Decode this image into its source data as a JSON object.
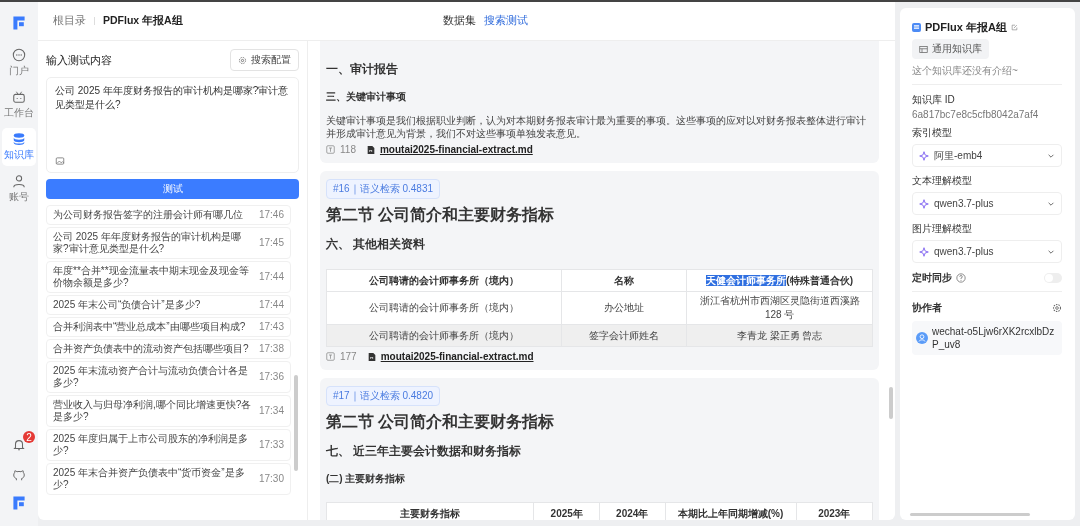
{
  "rail": {
    "items": [
      {
        "label": "门户",
        "kind": "chat",
        "selected": false
      },
      {
        "label": "工作台",
        "kind": "robot",
        "selected": false
      },
      {
        "label": "知识库",
        "kind": "database",
        "selected": true
      },
      {
        "label": "账号",
        "kind": "person",
        "selected": false
      }
    ],
    "notification_count": "2"
  },
  "breadcrumb": [
    "根目录",
    "PDFlux 年报A组"
  ],
  "nav_tabs": [
    {
      "label": "数据集",
      "selected": false
    },
    {
      "label": "搜索测试",
      "selected": true
    }
  ],
  "test_panel": {
    "title": "输入测试内容",
    "config_button": "搜索配置",
    "query": "公司 2025 年年度财务报告的审计机构是哪家?审计意见类型是什么?",
    "submit_button": "测试",
    "history": [
      {
        "question": "为公司财务报告签字的注册会计师有哪几位",
        "time": "17:46"
      },
      {
        "question": "公司 2025 年年度财务报告的审计机构是哪家?审计意见类型是什么?",
        "time": "17:45"
      },
      {
        "question": "年度**合并**现金流量表中期末现金及现金等价物余额是多少?",
        "time": "17:44"
      },
      {
        "question": "2025 年末公司“负债合计”是多少?",
        "time": "17:44"
      },
      {
        "question": "合并利润表中“营业总成本”由哪些项目构成?",
        "time": "17:43"
      },
      {
        "question": "合并资产负债表中的流动资产包括哪些项目?",
        "time": "17:38"
      },
      {
        "question": "2025 年末流动资产合计与流动负债合计各是多少?",
        "time": "17:36"
      },
      {
        "question": "营业收入与归母净利润,哪个同比增速更快?各是多少?",
        "time": "17:34"
      },
      {
        "question": "2025 年度归属于上市公司股东的净利润是多少?",
        "time": "17:33"
      },
      {
        "question": "2025 年末合并资产负债表中“货币资金”是多少?",
        "time": "17:30"
      }
    ]
  },
  "results": [
    {
      "blocks": [
        {
          "kind": "h2",
          "text": "一、审计报告"
        },
        {
          "kind": "h3",
          "text": "三、关键审计事项"
        },
        {
          "kind": "p",
          "text": "关键审计事项是我们根据职业判断，认为对本期财务报表审计最为重要的事项。这些事项的应对以对财务报表整体进行审计并形成审计意见为背景，我们不对这些事项单独发表意见。"
        }
      ],
      "count": "118",
      "file": "moutai2025-financial-extract.md"
    },
    {
      "badge": "#16｜语义检索 0.4831",
      "blocks": [
        {
          "kind": "h1",
          "text": "第二节 公司简介和主要财务指标"
        },
        {
          "kind": "h2",
          "text": "六、 其他相关资料"
        },
        {
          "kind": "table",
          "columns": [
            "公司聘请的会计师事务所（境内）",
            "名称",
            {
              "parts": [
                {
                  "text": "天健会计师事务所",
                  "selected": true
                },
                {
                  "text": "(特殊普通合伙)",
                  "selected": false
                }
              ]
            }
          ],
          "rows": [
            [
              "公司聘请的会计师事务所（境内）",
              "办公地址",
              "浙江省杭州市西湖区灵隐街道西溪路 128 号"
            ],
            [
              "公司聘请的会计师事务所（境内）",
              "签字会计师姓名",
              "李青龙 梁正勇 曾志"
            ]
          ]
        }
      ],
      "count": "177",
      "file": "moutai2025-financial-extract.md"
    },
    {
      "badge": "#17｜语义检索 0.4820",
      "blocks": [
        {
          "kind": "h1",
          "text": "第二节 公司简介和主要财务指标"
        },
        {
          "kind": "h2",
          "text": "七、 近三年主要会计数据和财务指标"
        },
        {
          "kind": "h3",
          "text": "(二) 主要财务指标"
        },
        {
          "kind": "table",
          "columns": [
            "主要财务指标",
            "2025年",
            "2024年",
            "本期比上年同期增减(%)",
            "2023年"
          ]
        }
      ]
    }
  ],
  "info_panel": {
    "title": "PDFlux 年报A组",
    "tag": "通用知识库",
    "description": "这个知识库还没有介绍~",
    "id_label": "知识库 ID",
    "id_value": "6a817bc7e8c5cfb8042a7af4",
    "selects": [
      {
        "label": "索引模型",
        "value": "阿里-emb4"
      },
      {
        "label": "文本理解模型",
        "value": "qwen3.7-plus"
      },
      {
        "label": "图片理解模型",
        "value": "qwen3.7-plus"
      }
    ],
    "sync": {
      "label": "定时同步",
      "on": false
    },
    "collaborators_label": "协作者",
    "collaborator": "wechat-o5Ljw6rXK2rcxlbDzP_uv8"
  }
}
